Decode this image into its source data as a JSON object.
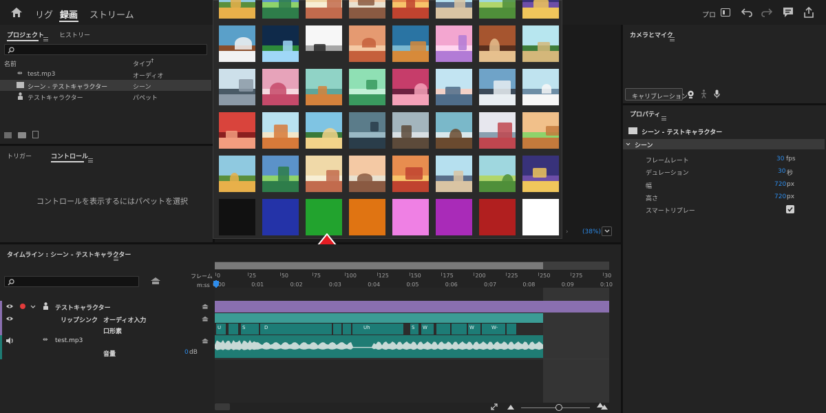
{
  "nav": {
    "tabs": [
      "リグ",
      "録画",
      "ストリーム"
    ],
    "right_label": "プロ"
  },
  "project_panel": {
    "tabs": [
      "プロジェクト",
      "ヒストリー"
    ],
    "search_placeholder": "",
    "columns": [
      "名前",
      "タイプ"
    ],
    "items": [
      {
        "name": "test.mp3",
        "type": "オーディオ"
      },
      {
        "name": "シーン - テストキャラクター",
        "type": "シーン"
      },
      {
        "name": "テストキャラクター",
        "type": "パペット"
      }
    ]
  },
  "controls_panel": {
    "tabs": [
      "トリガー",
      "コントロール"
    ],
    "empty_message": "コントロールを表示するにはパペットを選択"
  },
  "scene_zoom": "(38%)",
  "background_picker": {
    "rows": 5,
    "solid_colors": [
      "#111111",
      "#2433a8",
      "#22a32e",
      "#e07412",
      "#ef80e4",
      "#a92bb8",
      "#b11f1f",
      "#ffffff"
    ]
  },
  "camera_panel": {
    "title": "カメラとマイク",
    "calibrate_label": "キャリブレーション"
  },
  "properties_panel": {
    "title": "プロパティ",
    "object_name": "シーン - テストキャラクター",
    "section": "シーン",
    "rows": [
      {
        "label": "フレームレート",
        "value": "30",
        "unit": "fps"
      },
      {
        "label": "デュレーション",
        "value": "30",
        "unit": "秒"
      },
      {
        "label": "幅",
        "value": "720",
        "unit": "px"
      },
      {
        "label": "高さ",
        "value": "720",
        "unit": "px"
      },
      {
        "label": "スマートリプレー",
        "value": "",
        "unit": ""
      }
    ]
  },
  "timeline": {
    "title": "タイムライン : シーン - テストキャラクター",
    "frame_label": "フレーム",
    "time_label": "m:ss",
    "frame_ticks": [
      "0",
      "25",
      "50",
      "75",
      "100",
      "125",
      "150",
      "175",
      "200",
      "225",
      "250",
      "275",
      "30"
    ],
    "time_ticks": [
      "0:00",
      "0:01",
      "0:02",
      "0:03",
      "0:04",
      "0:05",
      "0:06",
      "0:07",
      "0:08",
      "0:09",
      "0:10"
    ],
    "tracks": {
      "puppet": "テストキャラクター",
      "lipsync": "リップシンク",
      "audio_input": "オーディオ入力",
      "visemes": "口形素",
      "audio_file": "test.mp3",
      "volume_label": "音量",
      "volume_value": "0",
      "volume_unit": "dB"
    },
    "viseme_labels": [
      "U",
      "S",
      "D",
      "Uh",
      "S",
      "W",
      "W",
      "W-"
    ]
  },
  "colors": {
    "accent": "#2d8ceb",
    "puppet_track": "#8a6fb0",
    "lipsync_track": "#3b9c95",
    "audio_track": "#1f7c74",
    "arrow": "#e51c23"
  }
}
